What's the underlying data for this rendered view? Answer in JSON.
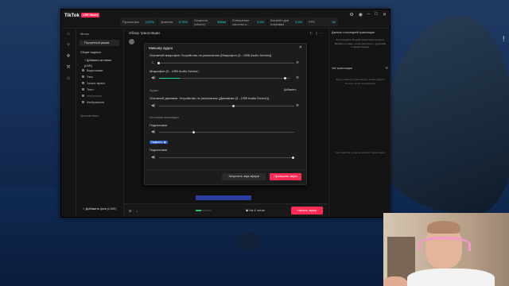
{
  "app": {
    "title": "TikTok",
    "badge": "LIVE Studio",
    "stats": [
      {
        "label": "Просмотры",
        "value": "0,02%"
      },
      {
        "label": "Зрители",
        "value": "0,76%"
      },
      {
        "label": "Скорость (кбит/с)",
        "value": "966kb"
      },
      {
        "label": "Отношение частоты к...",
        "value": "0,0%"
      },
      {
        "label": "Битрейт для отправки",
        "value": "0,0%"
      },
      {
        "label": "FPS",
        "value": "60"
      }
    ]
  },
  "sidebar": {
    "title": "Меню",
    "scene_select": "Портретный режим",
    "section": "Общие надписи",
    "add_source": "+ Добавить источник (LIVE)",
    "items": [
      {
        "label": "Видеозахват",
        "dim": false
      },
      {
        "label": "Окно",
        "dim": false
      },
      {
        "label": "Захват экрана",
        "dim": false
      },
      {
        "label": "Текст",
        "dim": false
      },
      {
        "label": "Мобильный",
        "dim": true
      },
      {
        "label": "Изображения",
        "dim": false
      }
    ],
    "text_item": "Простой текст",
    "add_scene": "+ Добавить фон (LIVE)"
  },
  "center": {
    "title": "Обзор трансляции",
    "bottom_pc": "◆ На 4 сетах",
    "go_live": "Начать эфир",
    "volume_fill": 0.35
  },
  "right": {
    "title": "Данные о последней трансляции",
    "desc": "За последние 30 дней трансляций не было. Выйдите в эфир, чтобы увеличить с друзьями и подписчиками.",
    "chat_title": "Чат трансляции",
    "chat_empty": "Здесь появится трансляция. Чтобы увидеть больше чатов, подтвердите",
    "chat_empty2": "Чат появится, когда вы начнёте трансляцию."
  },
  "modal": {
    "title": "Микшер аудио",
    "mic_label": "Основной микрофон Устройство по умолчанию (Микрофон (3 - USB Audio Device))",
    "mic_name": "Микрофон (3 - USB Audio Device)",
    "mic_level": 0.16,
    "mic_volume": 0.97,
    "audio_section": "Аудио",
    "add_link": "Добавить",
    "speaker_label": "Основной динамик: Устройство по умолчанию (Динамики (3 - USB Audio Device))",
    "speaker_volume": 0.55,
    "sources_section": "Источник анимации",
    "sub1_label": "Подписчики",
    "sub1_volume": 0.25,
    "toggle_text": "Подписч. ◉",
    "sub2_label": "Подписчики",
    "sub2_volume": 1.0,
    "test_button": "Запустить звук эфира",
    "check_button": "Проверить звуки"
  }
}
